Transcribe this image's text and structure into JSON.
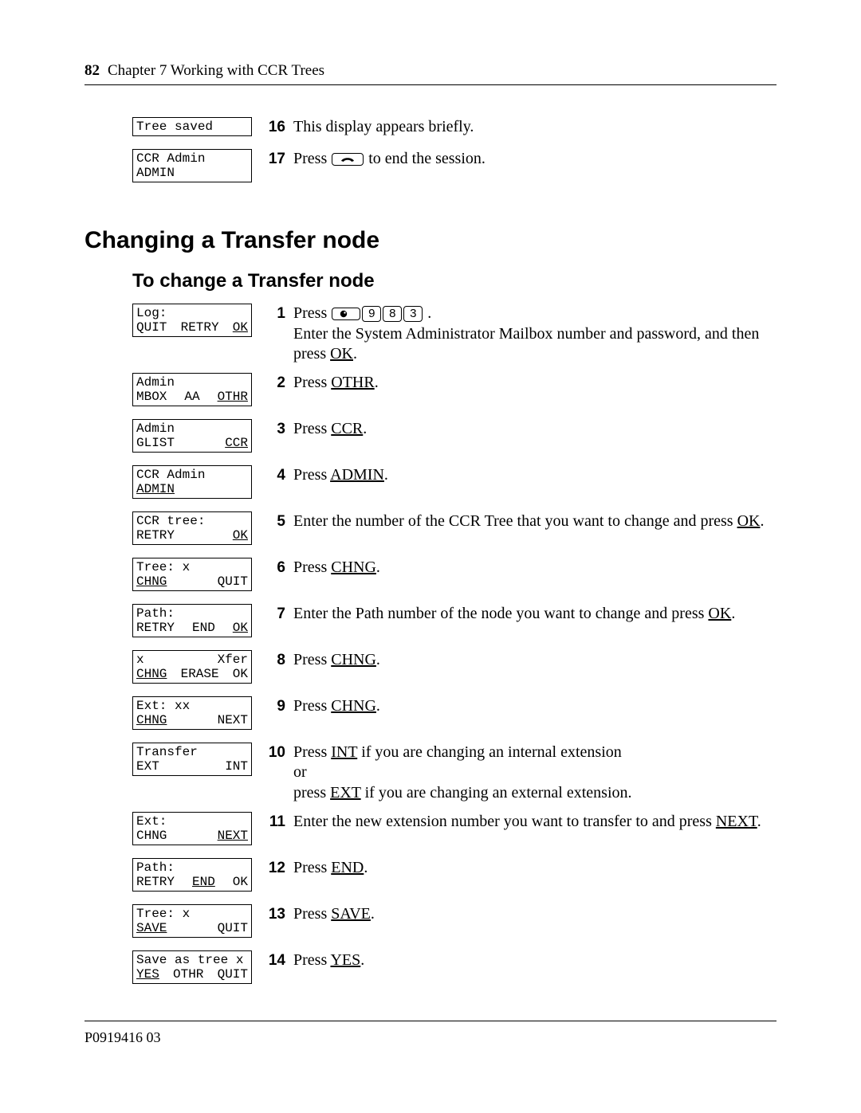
{
  "page_number": "82",
  "chapter_label": "Chapter 7  Working with CCR Trees",
  "footer_id": "P0919416 03",
  "intro_rows": [
    {
      "lcds": [
        {
          "lines": [
            [
              "Tree saved"
            ]
          ]
        }
      ],
      "num": "16",
      "text": [
        {
          "t": "This display appears briefly."
        }
      ]
    },
    {
      "lcds": [
        {
          "lines": [
            [
              "CCR Admin"
            ],
            [
              "ADMIN"
            ]
          ]
        }
      ],
      "num": "17",
      "text": [
        {
          "t": "Press "
        },
        {
          "phonekey": true
        },
        {
          "t": " to end the session."
        }
      ]
    }
  ],
  "section_title": "Changing a Transfer node",
  "subsection_title": "To change a Transfer node",
  "steps": [
    {
      "lcds": [
        {
          "lines": [
            [
              "Log:"
            ],
            [
              "QUIT",
              "RETRY",
              "_OK_"
            ]
          ]
        }
      ],
      "num": "1",
      "text": [
        {
          "t": "Press "
        },
        {
          "featurekey": true
        },
        {
          "keycap": "9"
        },
        {
          "keycap": "8"
        },
        {
          "keycap": "3"
        },
        {
          "t": " ."
        },
        {
          "br": true
        },
        {
          "t": "Enter the System Administrator Mailbox number and password, and then press "
        },
        {
          "soft": "OK"
        },
        {
          "t": "."
        }
      ]
    },
    {
      "lcds": [
        {
          "lines": [
            [
              "Admin"
            ],
            [
              "MBOX",
              "AA",
              "_OTHR_"
            ]
          ]
        }
      ],
      "num": "2",
      "text": [
        {
          "t": "Press "
        },
        {
          "soft": "OTHR"
        },
        {
          "t": "."
        }
      ]
    },
    {
      "lcds": [
        {
          "lines": [
            [
              "Admin"
            ],
            [
              "GLIST",
              "_CCR_"
            ]
          ]
        }
      ],
      "num": "3",
      "text": [
        {
          "t": "Press "
        },
        {
          "soft": "CCR"
        },
        {
          "t": "."
        }
      ]
    },
    {
      "lcds": [
        {
          "lines": [
            [
              "CCR Admin"
            ],
            [
              "_ADMIN_"
            ]
          ]
        }
      ],
      "num": "4",
      "text": [
        {
          "t": "Press "
        },
        {
          "soft": "ADMIN"
        },
        {
          "t": "."
        }
      ]
    },
    {
      "lcds": [
        {
          "lines": [
            [
              "CCR tree:"
            ],
            [
              "RETRY",
              "",
              "_OK_"
            ]
          ]
        }
      ],
      "num": "5",
      "text": [
        {
          "t": "Enter the number of the CCR Tree that you want to change and press "
        },
        {
          "soft": "OK"
        },
        {
          "t": "."
        }
      ]
    },
    {
      "lcds": [
        {
          "lines": [
            [
              "Tree: x"
            ],
            [
              "_CHNG_",
              "",
              "QUIT"
            ]
          ]
        }
      ],
      "num": "6",
      "text": [
        {
          "t": "Press "
        },
        {
          "soft": "CHNG"
        },
        {
          "t": "."
        }
      ]
    },
    {
      "lcds": [
        {
          "lines": [
            [
              "Path:"
            ],
            [
              "RETRY",
              "END",
              "_OK_"
            ]
          ]
        }
      ],
      "num": "7",
      "text": [
        {
          "t": "Enter the Path number of the node you want to change and press "
        },
        {
          "soft": "OK"
        },
        {
          "t": "."
        }
      ]
    },
    {
      "lcds": [
        {
          "lines": [
            [
              "x",
              "",
              "Xfer"
            ],
            [
              "_CHNG_",
              "ERASE",
              "OK"
            ]
          ]
        }
      ],
      "num": "8",
      "text": [
        {
          "t": "Press "
        },
        {
          "soft": "CHNG"
        },
        {
          "t": "."
        }
      ]
    },
    {
      "lcds": [
        {
          "lines": [
            [
              "Ext: xx"
            ],
            [
              "_CHNG_",
              "",
              "NEXT"
            ]
          ]
        }
      ],
      "num": "9",
      "text": [
        {
          "t": "Press "
        },
        {
          "soft": "CHNG"
        },
        {
          "t": "."
        }
      ]
    },
    {
      "lcds": [
        {
          "lines": [
            [
              "Transfer"
            ],
            [
              "EXT",
              "INT"
            ]
          ]
        }
      ],
      "num": "10",
      "text": [
        {
          "t": "Press "
        },
        {
          "soft": "INT"
        },
        {
          "t": " if you are changing an internal extension"
        },
        {
          "br": true
        },
        {
          "t": "or"
        },
        {
          "br": true
        },
        {
          "t": "press "
        },
        {
          "soft": "EXT"
        },
        {
          "t": " if you are changing an external extension."
        }
      ]
    },
    {
      "lcds": [
        {
          "lines": [
            [
              "Ext:"
            ],
            [
              "CHNG",
              "",
              "_NEXT_"
            ]
          ]
        }
      ],
      "num": "11",
      "text": [
        {
          "t": "Enter the new extension number you want to transfer to and press "
        },
        {
          "soft": "NEXT"
        },
        {
          "t": "."
        }
      ]
    },
    {
      "lcds": [
        {
          "lines": [
            [
              "Path:"
            ],
            [
              "RETRY",
              "_END_",
              "OK"
            ]
          ]
        }
      ],
      "num": "12",
      "text": [
        {
          "t": "Press "
        },
        {
          "soft": "END"
        },
        {
          "t": "."
        }
      ]
    },
    {
      "lcds": [
        {
          "lines": [
            [
              "Tree: x"
            ],
            [
              "_SAVE_",
              "",
              "QUIT"
            ]
          ]
        }
      ],
      "num": "13",
      "text": [
        {
          "t": "Press "
        },
        {
          "soft": "SAVE"
        },
        {
          "t": "."
        }
      ]
    },
    {
      "lcds": [
        {
          "lines": [
            [
              "Save as tree x"
            ],
            [
              "_YES_",
              "OTHR",
              "QUIT"
            ]
          ]
        }
      ],
      "num": "14",
      "text": [
        {
          "t": "Press "
        },
        {
          "soft": "YES"
        },
        {
          "t": "."
        }
      ]
    }
  ]
}
